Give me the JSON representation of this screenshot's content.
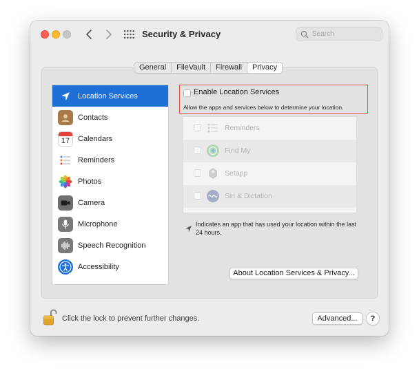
{
  "window": {
    "title": "Security & Privacy",
    "search_placeholder": "Search"
  },
  "tabs": [
    "General",
    "FileVault",
    "Firewall",
    "Privacy"
  ],
  "active_tab": "Privacy",
  "sidebar": {
    "items": [
      {
        "label": "Location Services",
        "icon": "location-arrow-icon",
        "selected": true
      },
      {
        "label": "Contacts",
        "icon": "contacts-icon"
      },
      {
        "label": "Calendars",
        "icon": "calendar-icon",
        "icon_text": "17"
      },
      {
        "label": "Reminders",
        "icon": "reminders-icon"
      },
      {
        "label": "Photos",
        "icon": "photos-icon"
      },
      {
        "label": "Camera",
        "icon": "camera-icon"
      },
      {
        "label": "Microphone",
        "icon": "microphone-icon"
      },
      {
        "label": "Speech Recognition",
        "icon": "waveform-icon"
      },
      {
        "label": "Accessibility",
        "icon": "accessibility-icon"
      }
    ]
  },
  "location": {
    "enable_label": "Enable Location Services",
    "enable_description": "Allow the apps and services below to determine your location.",
    "enabled": false,
    "apps": [
      {
        "label": "Reminders",
        "icon": "reminders-icon"
      },
      {
        "label": "Find My",
        "icon": "find-my-icon"
      },
      {
        "label": "Setapp",
        "icon": "setapp-icon"
      },
      {
        "label": "Siri & Dictation",
        "icon": "siri-icon"
      }
    ],
    "note": "Indicates an app that has used your location within the last 24 hours.",
    "about_button": "About Location Services & Privacy..."
  },
  "footer": {
    "lock_text": "Click the lock to prevent further changes.",
    "advanced_button": "Advanced...",
    "help_button": "?"
  },
  "colors": {
    "selection": "#1f6fd8",
    "highlight_border": "#e2513f"
  }
}
